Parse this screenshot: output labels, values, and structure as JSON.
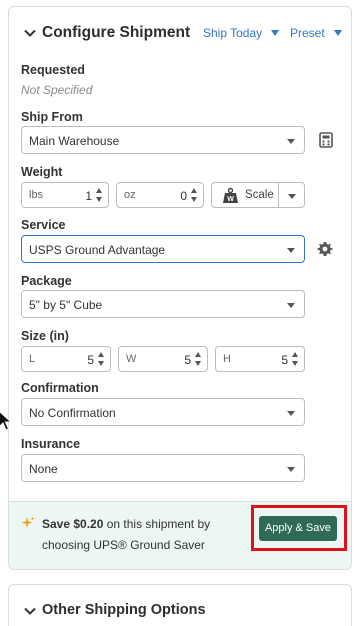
{
  "header": {
    "title": "Configure Shipment",
    "ship_today": "Ship Today",
    "preset": "Preset"
  },
  "requested": {
    "label": "Requested",
    "value": "Not Specified"
  },
  "ship_from": {
    "label": "Ship From",
    "value": "Main Warehouse"
  },
  "weight": {
    "label": "Weight",
    "lbs_unit": "lbs",
    "lbs_value": "1",
    "oz_unit": "oz",
    "oz_value": "0",
    "scale_label": "Scale"
  },
  "service": {
    "label": "Service",
    "value": "USPS Ground Advantage"
  },
  "package": {
    "label": "Package",
    "value": "5\" by 5\" Cube"
  },
  "size": {
    "label": "Size (in)",
    "l_unit": "L",
    "l_value": "5",
    "w_unit": "W",
    "w_value": "5",
    "h_unit": "H",
    "h_value": "5"
  },
  "confirmation": {
    "label": "Confirmation",
    "value": "No Confirmation"
  },
  "insurance": {
    "label": "Insurance",
    "value": "None"
  },
  "promo": {
    "save_prefix": "Save $0.20",
    "save_rest": " on this shipment by choosing UPS® Ground Saver",
    "apply_label": "Apply & Save"
  },
  "other": {
    "title": "Other Shipping Options"
  },
  "colors": {
    "link": "#2f78c4",
    "apply_button": "#2e6a55",
    "promo_bg": "#ecf7f3",
    "highlight": "#e0111b",
    "sparkle": "#f0a020"
  }
}
